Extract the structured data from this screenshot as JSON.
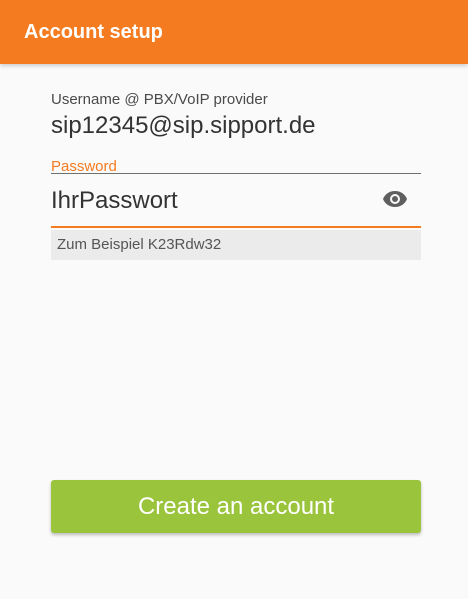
{
  "app_bar": {
    "title": "Account setup",
    "background": "#f47b20"
  },
  "form": {
    "username": {
      "label": "Username @ PBX/VoIP provider",
      "value": "sip12345@sip.sipport.de"
    },
    "password": {
      "label": "Password",
      "value": "IhrPasswort",
      "visibility_icon": "eye-icon",
      "hint": "Zum Beispiel K23Rdw32",
      "focused": true
    }
  },
  "actions": {
    "create_account_label": "Create an account",
    "create_account_color": "#9ac43c"
  }
}
